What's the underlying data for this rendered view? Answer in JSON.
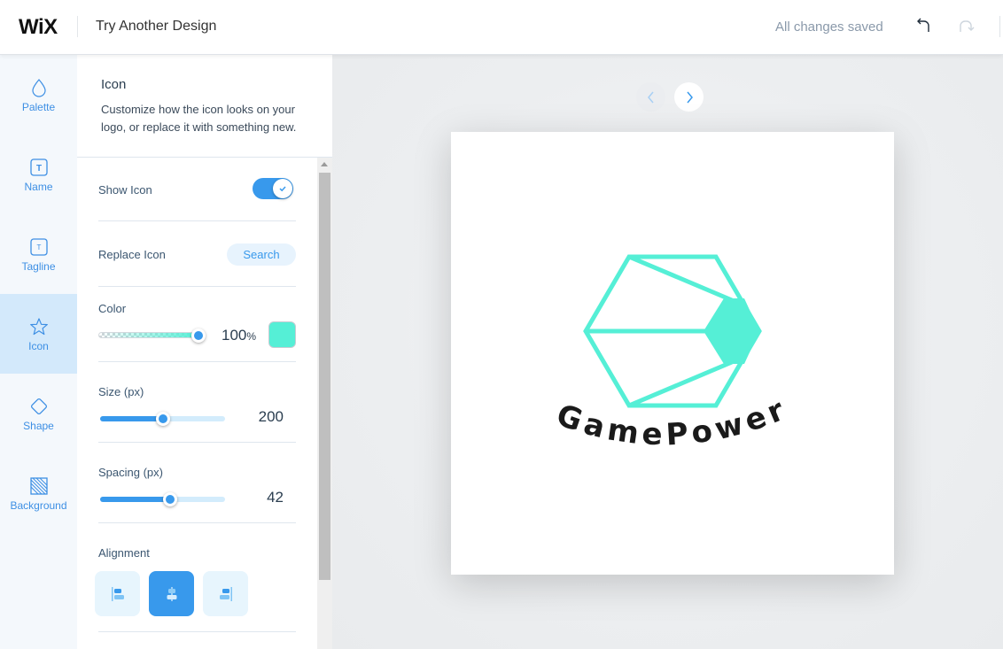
{
  "topbar": {
    "logo": "WiX",
    "title": "Try Another Design",
    "status": "All changes saved"
  },
  "nav": {
    "items": [
      {
        "label": "Palette",
        "icon": "drop-icon"
      },
      {
        "label": "Name",
        "icon": "text-box-icon"
      },
      {
        "label": "Tagline",
        "icon": "small-text-box-icon"
      },
      {
        "label": "Icon",
        "icon": "star-icon",
        "active": true
      },
      {
        "label": "Shape",
        "icon": "diamond-icon"
      },
      {
        "label": "Background",
        "icon": "hatched-square-icon"
      }
    ]
  },
  "panel": {
    "title": "Icon",
    "description": "Customize how the icon looks on your logo, or replace it with something new.",
    "show_icon": {
      "label": "Show Icon",
      "value": true
    },
    "replace_icon": {
      "label": "Replace Icon",
      "button": "Search"
    },
    "color": {
      "label": "Color",
      "opacity": "100",
      "opacity_unit": "%",
      "swatch": "#55efd6"
    },
    "size": {
      "label": "Size (px)",
      "value": "200",
      "fraction": 0.5
    },
    "spacing": {
      "label": "Spacing (px)",
      "value": "42",
      "fraction": 0.56
    },
    "alignment": {
      "label": "Alignment",
      "options": [
        "left",
        "center",
        "right"
      ],
      "selected": "center"
    }
  },
  "preview": {
    "brand_name": "GamePower",
    "icon_color": "#55efd6",
    "text_color": "#1a1a1a"
  }
}
